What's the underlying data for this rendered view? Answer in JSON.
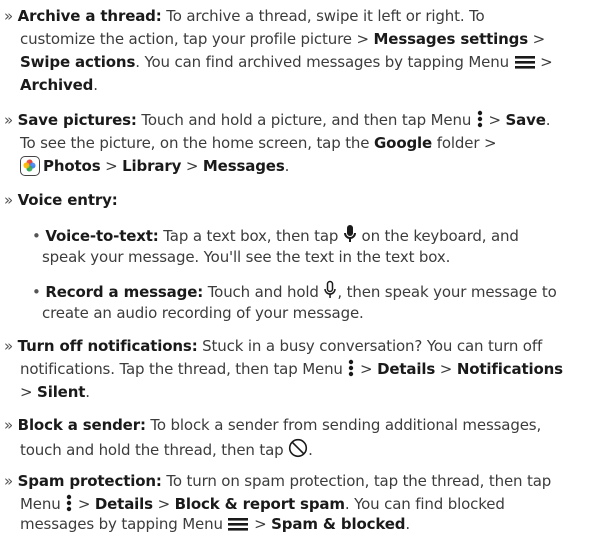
{
  "archive": {
    "bullet": "»",
    "title": "Archive a thread:",
    "t1": " To archive a thread, swipe it left or right. To",
    "t2": "customize the action, tap your profile picture > ",
    "b1": "Messages settings",
    "t3": " >",
    "b2": "Swipe actions",
    "t4": ". You can find archived messages by tapping Menu ",
    "t5": " >",
    "b3": "Archived",
    "t6": "."
  },
  "save": {
    "bullet": "»",
    "title": "Save pictures:",
    "t1": " Touch and hold a picture, and then tap Menu ",
    "t2": " > ",
    "b1": "Save",
    "t3": ".",
    "t4": "To see the picture, on the home screen, tap the ",
    "b2": "Google",
    "t5": " folder >",
    "b3": "Photos",
    "t6": " > ",
    "b4": "Library",
    "t7": " > ",
    "b5": "Messages",
    "t8": "."
  },
  "voice": {
    "bullet": "»",
    "title": "Voice entry:",
    "sub1": {
      "bullet": "•",
      "title": "Voice-to-text:",
      "t1": " Tap a text box, then tap ",
      "t2": " on the keyboard, and",
      "t3": "speak your message. You'll see the text in the text box."
    },
    "sub2": {
      "bullet": "•",
      "title": "Record a message:",
      "t1": " Touch and hold ",
      "t2": ", then speak your message to",
      "t3": "create an audio recording of your message."
    }
  },
  "notif": {
    "bullet": "»",
    "title": "Turn off notifications:",
    "t1": " Stuck in a busy conversation? You can turn off",
    "t2": "notifications. Tap the thread, then tap Menu ",
    "t3": " > ",
    "b1": "Details",
    "t4": " > ",
    "b2": "Notifications",
    "t5": "> ",
    "b3": "Silent",
    "t6": "."
  },
  "block": {
    "bullet": "»",
    "title": "Block a sender:",
    "t1": " To block a sender from sending additional messages,",
    "t2": "touch and hold the thread, then tap ",
    "t3": "."
  },
  "spam": {
    "bullet": "»",
    "title": "Spam protection:",
    "t1": " To turn on spam protection, tap the thread, then tap",
    "t2": "Menu ",
    "t3": " > ",
    "b1": "Details",
    "t4": " > ",
    "b2": "Block & report spam",
    "t5": ". You can find blocked",
    "t6": "messages by tapping Menu ",
    "t7": " > ",
    "b3": "Spam & blocked",
    "t8": "."
  }
}
